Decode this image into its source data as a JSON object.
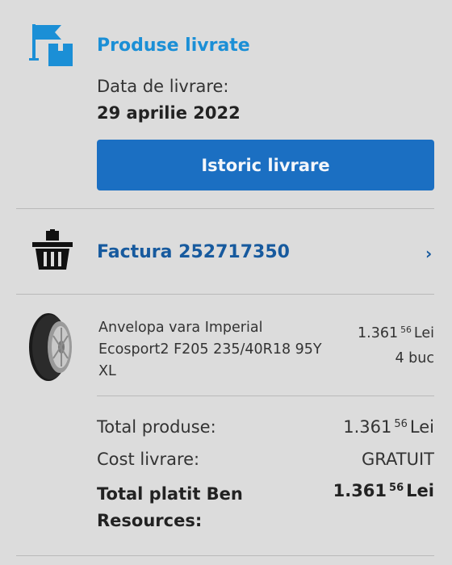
{
  "delivery": {
    "title": "Produse livrate",
    "date_label": "Data de livrare:",
    "date_value": "29 aprilie 2022",
    "history_button": "Istoric livrare"
  },
  "invoice": {
    "label": "Factura 252717350",
    "chevron": "›"
  },
  "product": {
    "name": "Anvelopa vara Imperial Ecosport2 F205 235/40R18 95Y XL",
    "price_int": "1.361",
    "price_cents": "56",
    "currency": "Lei",
    "quantity": "4 buc"
  },
  "summary": {
    "total_products_label": "Total produse:",
    "total_products_int": "1.361",
    "total_products_cents": "56",
    "total_products_currency": "Lei",
    "shipping_label": "Cost livrare:",
    "shipping_value": "GRATUIT",
    "paid_label": "Total platit Ben Resources:",
    "paid_int": "1.361",
    "paid_cents": "56",
    "paid_currency": "Lei"
  },
  "colors": {
    "background": "#dcdcdc",
    "accent_light": "#1b8fd6",
    "accent_dark": "#175a9e",
    "button": "#1b6fc2"
  },
  "icons": {
    "delivery": "flag-box-icon",
    "invoice": "basket-icon",
    "product": "tire-image"
  }
}
